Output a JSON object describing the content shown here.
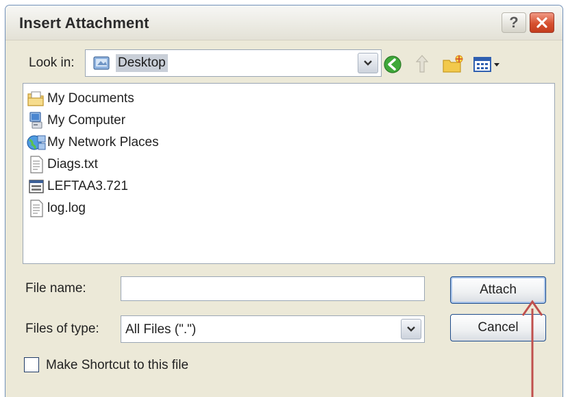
{
  "dialog": {
    "title": "Insert Attachment",
    "help_label": "?",
    "lookin_label": "Look in:",
    "lookin_value": "Desktop",
    "files": [
      {
        "name": "My Documents",
        "icon": "my-documents-icon"
      },
      {
        "name": "My Computer",
        "icon": "my-computer-icon"
      },
      {
        "name": "My Network Places",
        "icon": "network-places-icon"
      },
      {
        "name": "Diags.txt",
        "icon": "text-file-icon"
      },
      {
        "name": "LEFTAA3.721",
        "icon": "generic-file-icon"
      },
      {
        "name": "log.log",
        "icon": "text-file-icon"
      }
    ],
    "filename_label": "File name:",
    "filename_value": "",
    "filetype_label": "Files of type:",
    "filetype_value": "All Files (\".\")",
    "attach_label": "Attach",
    "cancel_label": "Cancel",
    "shortcut_label": "Make Shortcut to this file"
  },
  "colors": {
    "dialog_bg": "#ece9d8",
    "annotation_arrow": "#c0504d",
    "close_button": "#d6502f"
  }
}
